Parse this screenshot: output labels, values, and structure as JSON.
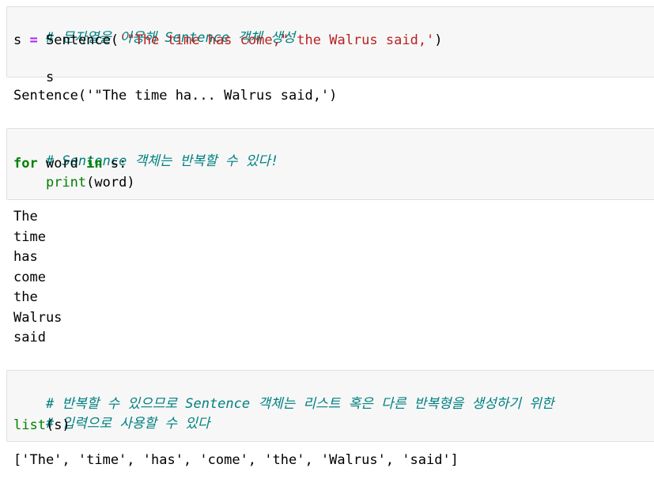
{
  "cells": [
    {
      "input": {
        "comment": "# 문자열을 이용해 Sentence 객체 생성",
        "line2": {
          "var": "s",
          "op": "=",
          "func": "Sentence(",
          "str": "'\"The time has come,\" the Walrus said,'",
          "close": ")"
        },
        "line3": "s"
      },
      "output": "Sentence('\"The time ha... Walrus said,')"
    },
    {
      "input": {
        "comment": "# Sentence 객체는 반복할 수 있다!",
        "line2": {
          "kw_for": "for",
          "word": " word ",
          "kw_in": "in",
          "rest": " s:"
        },
        "line3": {
          "indent": "    ",
          "func": "print",
          "args": "(word)"
        }
      },
      "output_lines": [
        "The",
        "time",
        "has",
        "come",
        "the",
        "Walrus",
        "said"
      ]
    },
    {
      "input": {
        "comment1": "# 반복할 수 있으므로 Sentence 객체는 리스트 혹은 다른 반복형을 생성하기 위한",
        "comment2": "# 입력으로 사용할 수 있다",
        "line3": {
          "func": "list",
          "args": "(s)"
        }
      },
      "output": "['The', 'time', 'has', 'come', 'the', 'Walrus', 'said']"
    }
  ]
}
